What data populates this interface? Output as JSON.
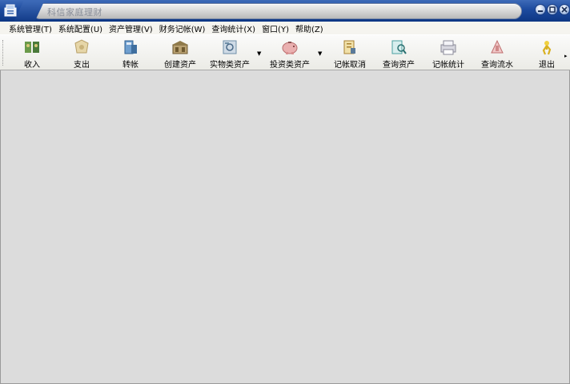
{
  "window": {
    "title": "科信家庭理财"
  },
  "menu": [
    {
      "label": "系统管理(T)"
    },
    {
      "label": "系统配置(U)"
    },
    {
      "label": "资产管理(V)"
    },
    {
      "label": "财务记帐(W)"
    },
    {
      "label": "查询统计(X)"
    },
    {
      "label": "窗口(Y)"
    },
    {
      "label": "帮助(Z)"
    }
  ],
  "toolbar": {
    "buttons": [
      {
        "label": "收入",
        "icon": "income-icon",
        "color": "#4a8a3a"
      },
      {
        "label": "支出",
        "icon": "expense-icon",
        "color": "#c9b27a"
      },
      {
        "label": "转帐",
        "icon": "transfer-icon",
        "color": "#3f6f9f"
      },
      {
        "label": "创建资产",
        "icon": "create-asset-icon",
        "color": "#8f7a4a"
      },
      {
        "label": "实物类资产",
        "icon": "physical-asset-icon",
        "color": "#6f8fa8",
        "dropdown": true
      },
      {
        "label": "投资类资产",
        "icon": "piggy-bank-icon",
        "color": "#e0a0a0",
        "dropdown": true
      },
      {
        "label": "记帐取消",
        "icon": "cancel-entry-icon",
        "color": "#c8a040"
      },
      {
        "label": "查询资产",
        "icon": "query-asset-icon",
        "color": "#4aa0a0"
      },
      {
        "label": "记帐统计",
        "icon": "statistics-icon",
        "color": "#9a9aa8"
      },
      {
        "label": "查询流水",
        "icon": "query-flow-icon",
        "color": "#d08a8a"
      },
      {
        "label": "退出",
        "icon": "exit-icon",
        "color": "#e0c020"
      }
    ]
  }
}
